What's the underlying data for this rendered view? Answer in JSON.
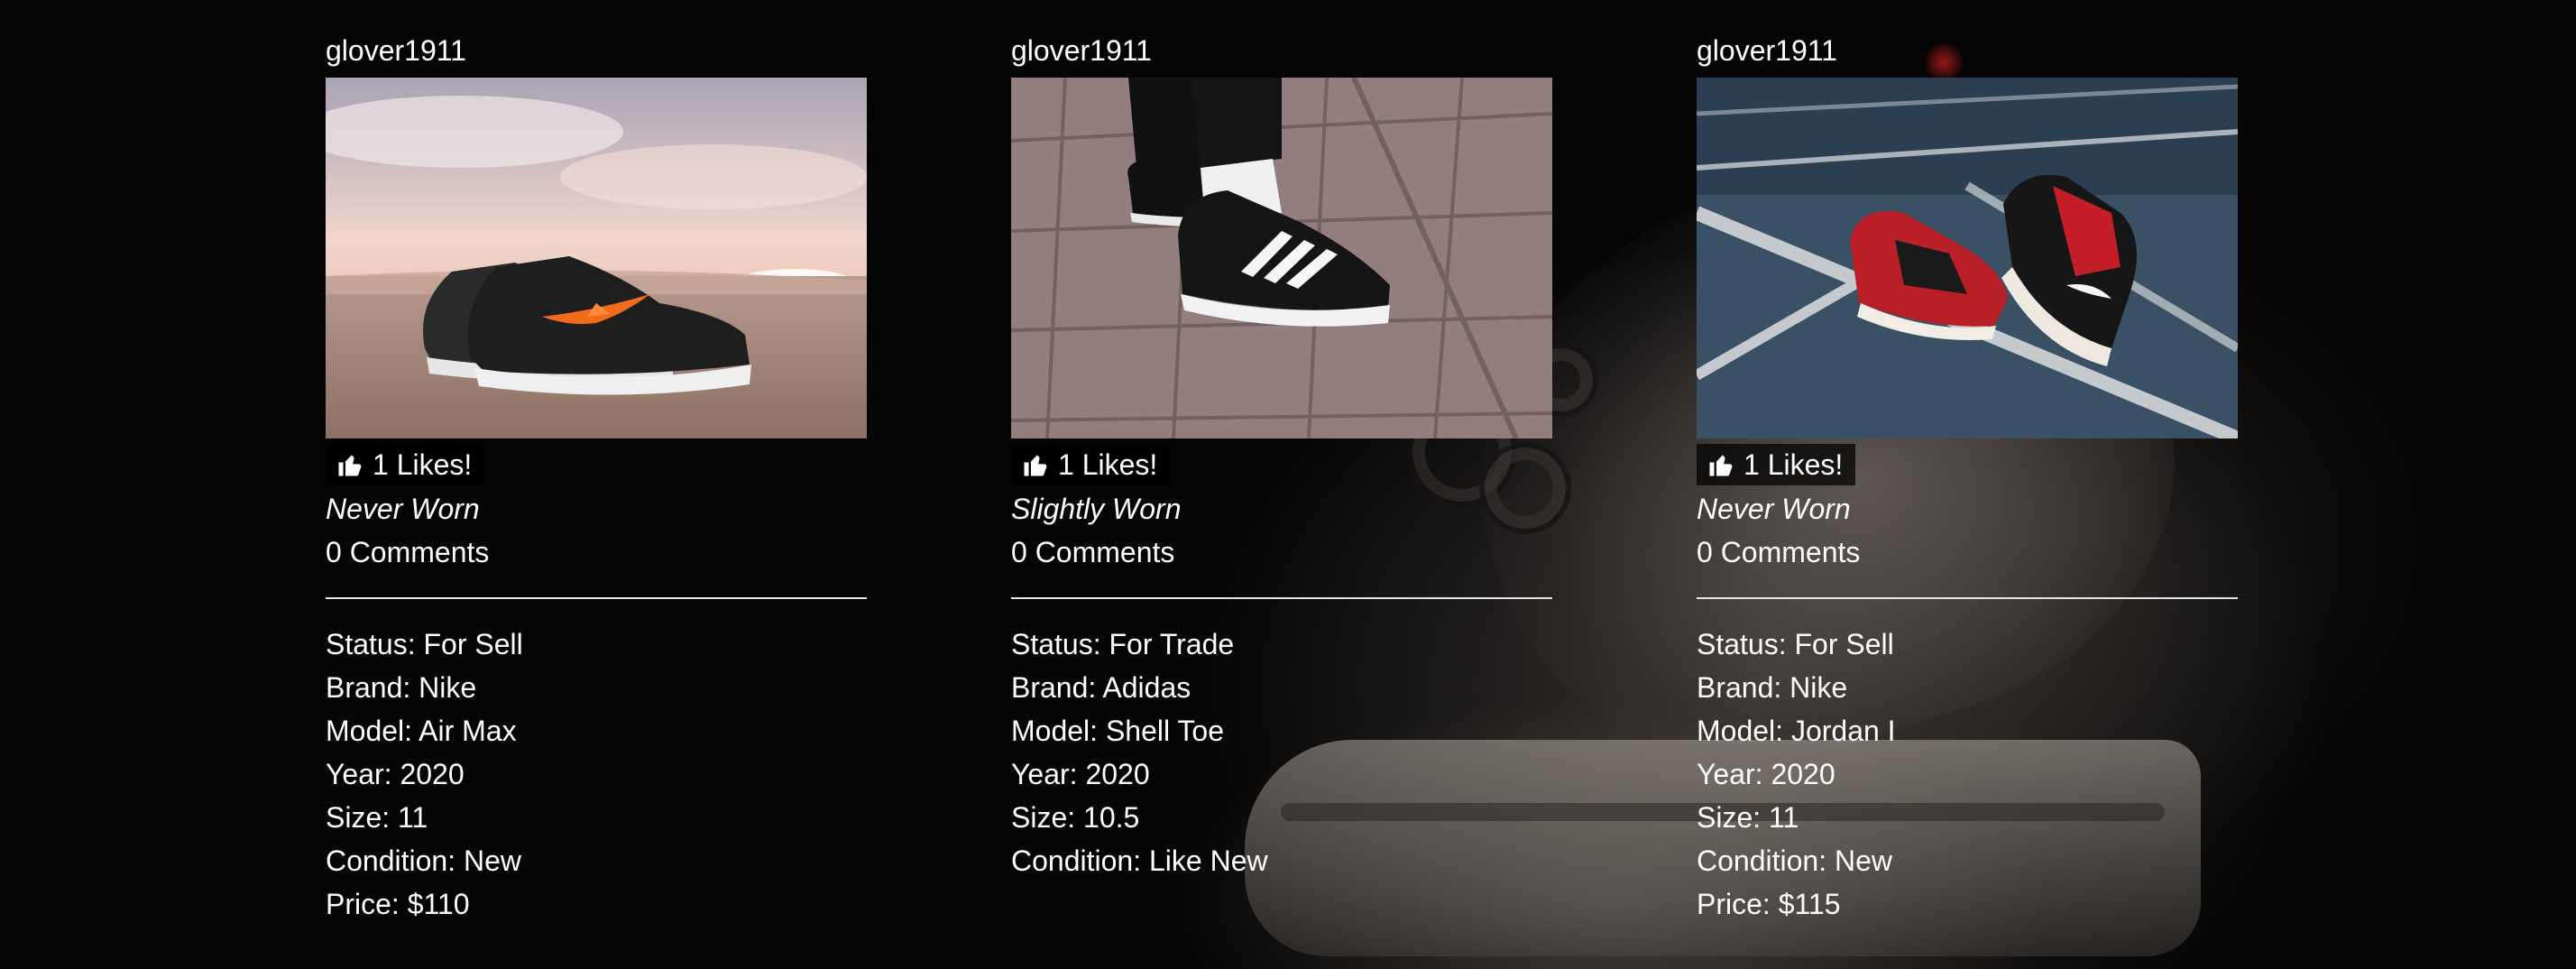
{
  "posts": [
    {
      "username": "glover1911",
      "likes_label": "1 Likes!",
      "wear": "Never Worn",
      "comments_label": "0 Comments",
      "status": "Status: For Sell",
      "brand": "Brand: Nike",
      "model": "Model: Air Max",
      "year": "Year: 2020",
      "size": "Size: 11",
      "condition": "Condition: New",
      "price": "Price: $110"
    },
    {
      "username": "glover1911",
      "likes_label": "1 Likes!",
      "wear": "Slightly Worn",
      "comments_label": "0 Comments",
      "status": "Status: For Trade",
      "brand": "Brand: Adidas",
      "model": "Model: Shell Toe",
      "year": "Year: 2020",
      "size": "Size: 10.5",
      "condition": "Condition: Like New"
    },
    {
      "username": "glover1911",
      "likes_label": "1 Likes!",
      "wear": "Never Worn",
      "comments_label": "0 Comments",
      "status": "Status: For Sell",
      "brand": "Brand: Nike",
      "model": "Model: Jordan I",
      "year": "Year: 2020",
      "size": "Size: 11",
      "condition": "Condition: New",
      "price": "Price: $115"
    }
  ],
  "icons": {
    "like": "thumbs-up-icon"
  },
  "colors": {
    "text": "#ffffff",
    "divider": "#e6e6e6",
    "background": "#050505"
  }
}
